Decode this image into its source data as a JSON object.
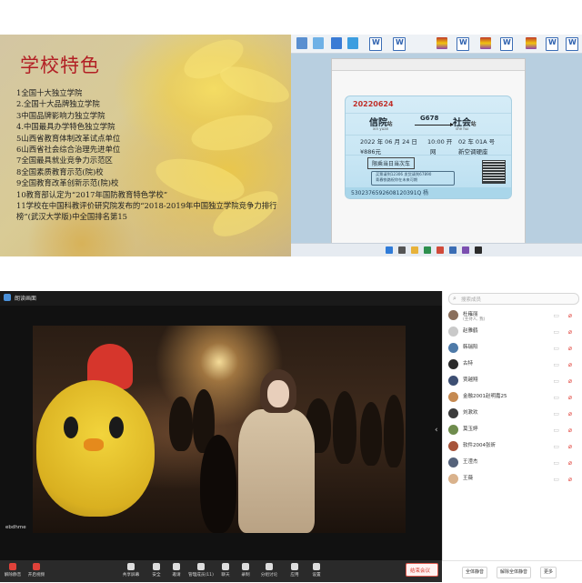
{
  "slide": {
    "title": "学校特色",
    "items": [
      "1全国十大独立学院",
      "2.全国十大品牌独立学院",
      "3中国品牌影响力独立学院",
      "4.中国最具办学特色独立学院",
      "5山西省教育体制改革试点单位",
      "6山西省社会综合治理先进单位",
      "7全国最具就业竞争力示范区",
      "8全国素质教育示范(院)校",
      "9全国教育改革创新示范(院)校",
      "10教育部认定为“2017年国防教育特色学校”",
      "11学校在中国科教评价研究院发布的“2018-2019年中国独立学院竞争力排行榜”(武汉大学版)中全国排名第15"
    ]
  },
  "ticket": {
    "date_code": "20220624",
    "from_station": "信院",
    "to_station": "社会",
    "station_suffix": "站",
    "from_pinyin": "xin yuan",
    "to_pinyin": "she hui",
    "train_no": "G678",
    "datetime": "2022 年 06 月 24 日",
    "time": "10:00 开",
    "seat": "02 车 01A 号",
    "price": "¥886元",
    "ticket_type": "网",
    "car_class": "新空调硬座",
    "note": "限乘当日当次车",
    "notice_line1": "买票请到12306 发货请到67890",
    "notice_line2": "青春铁路祝你在未来可期",
    "serial": "5302376592608120391Q 杨"
  },
  "zoom": {
    "top_label": "朗读画面",
    "video_caption": "ebdhme"
  },
  "panel": {
    "search_placeholder": "搜索成员",
    "participants": [
      {
        "name": "杜雍丽",
        "sub": "(主持人, 我)",
        "color": "#8a6f5c"
      },
      {
        "name": "赵雅鹤",
        "sub": "",
        "color": "#c9c9c9"
      },
      {
        "name": "韩瑞阳",
        "sub": "",
        "color": "#4e7aa8"
      },
      {
        "name": "古特",
        "sub": "",
        "color": "#2b2b2b"
      },
      {
        "name": "贾越翔",
        "sub": "",
        "color": "#3d4f73"
      },
      {
        "name": "金融2001赵明嘉25",
        "sub": "",
        "color": "#c58a52"
      },
      {
        "name": "刘漱欢",
        "sub": "",
        "color": "#3b3b3b"
      },
      {
        "name": "莫玉婷",
        "sub": "",
        "color": "#6f8c4d"
      },
      {
        "name": "软件2004张昕",
        "sub": "",
        "color": "#a7543a"
      },
      {
        "name": "王滢杰",
        "sub": "",
        "color": "#55627a"
      },
      {
        "name": "王薇",
        "sub": "",
        "color": "#d9b28c"
      }
    ],
    "mute_all": "全体静音",
    "unmute_all": "解除全体静音",
    "more": "更多"
  },
  "toolbar": {
    "buttons": [
      {
        "label": "解除静音"
      },
      {
        "label": "开启视频"
      },
      {
        "label": "共享屏幕"
      },
      {
        "label": "安全"
      },
      {
        "label": "邀请"
      },
      {
        "label": "管理成员(11)"
      },
      {
        "label": "聊天"
      },
      {
        "label": "录制"
      },
      {
        "label": "分组讨论"
      },
      {
        "label": "应用"
      },
      {
        "label": "设置"
      }
    ],
    "end_meeting": "结束会议"
  },
  "colors": {
    "slide_title": "#b21f24",
    "mute_red": "#e0423a",
    "end_red": "#d83a30"
  }
}
